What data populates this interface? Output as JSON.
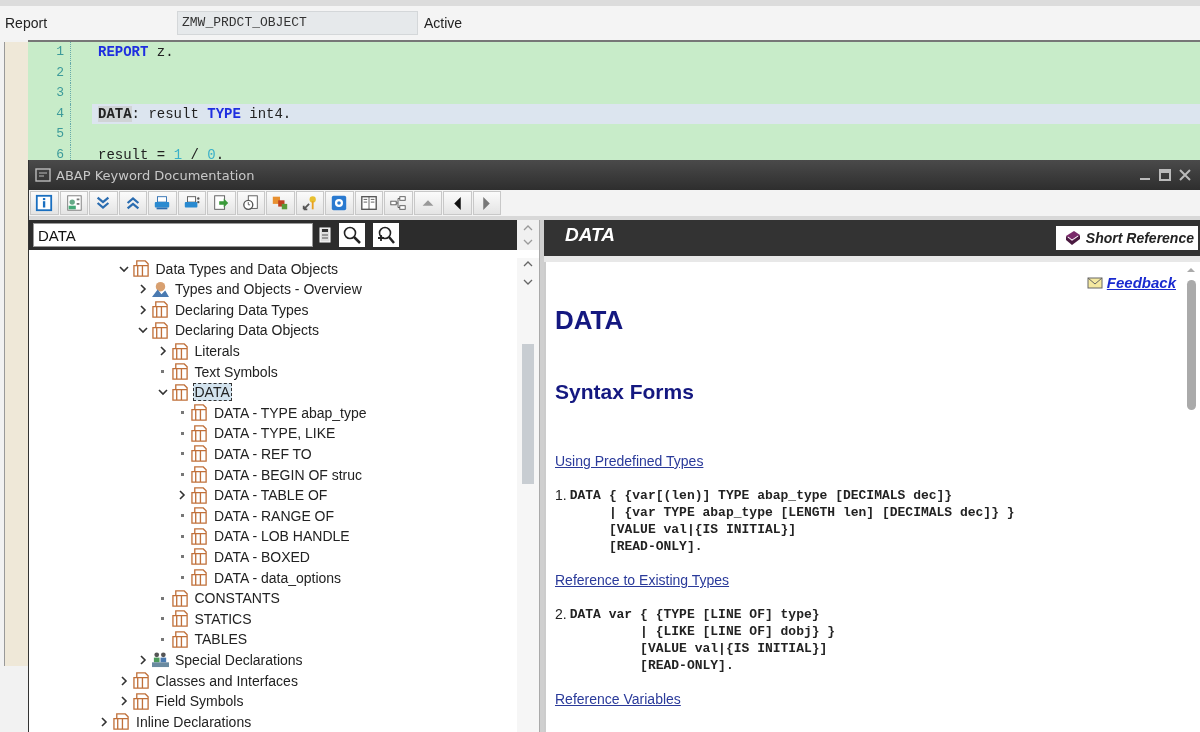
{
  "header": {
    "label": "Report",
    "program": "ZMW_PRDCT_OBJECT",
    "status": "Active"
  },
  "editor": {
    "lines": [
      {
        "number": "1",
        "highlighted": false,
        "tokens": [
          {
            "kind": "keyword",
            "text": "REPORT"
          },
          {
            "kind": "text",
            "text": " z."
          }
        ]
      },
      {
        "number": "2",
        "highlighted": false
      },
      {
        "number": "3",
        "highlighted": false
      },
      {
        "number": "4",
        "highlighted": true,
        "tokens": [
          {
            "kind": "marked",
            "text": "DATA"
          },
          {
            "kind": "text",
            "text": ": result "
          },
          {
            "kind": "keyword",
            "text": "TYPE"
          },
          {
            "kind": "text",
            "text": " int4."
          }
        ]
      },
      {
        "number": "5",
        "highlighted": false
      },
      {
        "number": "6",
        "highlighted": false,
        "tokens": [
          {
            "kind": "text",
            "text": "result = "
          },
          {
            "kind": "number",
            "text": "1"
          },
          {
            "kind": "text",
            "text": " / "
          },
          {
            "kind": "number",
            "text": "0"
          },
          {
            "kind": "text",
            "text": "."
          }
        ]
      }
    ]
  },
  "doc_window": {
    "title": "ABAP Keyword Documentation",
    "search": {
      "value": "DATA"
    },
    "tree": {
      "scrolled_branch": [
        {
          "label": "Data Types and Data Objects",
          "expandable": true,
          "expanded": true,
          "kind": "topic",
          "selected": false,
          "children": [
            {
              "label": "Types and Objects - Overview",
              "expandable": true,
              "expanded": false,
              "kind": "overview",
              "selected": false
            },
            {
              "label": "Declaring Data Types",
              "expandable": true,
              "expanded": false,
              "kind": "topic",
              "selected": false
            },
            {
              "label": "Declaring Data Objects",
              "expandable": true,
              "expanded": true,
              "kind": "topic",
              "selected": false,
              "children": [
                {
                  "label": "Literals",
                  "expandable": true,
                  "expanded": false,
                  "kind": "topic",
                  "selected": false
                },
                {
                  "label": "Text Symbols",
                  "expandable": false,
                  "kind": "topic",
                  "selected": false
                },
                {
                  "label": "DATA",
                  "expandable": true,
                  "expanded": true,
                  "kind": "topic",
                  "selected": true,
                  "children": [
                    {
                      "label": "DATA - TYPE abap_type",
                      "expandable": false,
                      "kind": "topic",
                      "selected": false
                    },
                    {
                      "label": "DATA - TYPE, LIKE",
                      "expandable": false,
                      "kind": "topic",
                      "selected": false
                    },
                    {
                      "label": "DATA - REF TO",
                      "expandable": false,
                      "kind": "topic",
                      "selected": false
                    },
                    {
                      "label": "DATA - BEGIN OF struc",
                      "expandable": false,
                      "kind": "topic",
                      "selected": false
                    },
                    {
                      "label": "DATA - TABLE OF",
                      "expandable": true,
                      "expanded": false,
                      "kind": "topic",
                      "selected": false
                    },
                    {
                      "label": "DATA - RANGE OF",
                      "expandable": false,
                      "kind": "topic",
                      "selected": false
                    },
                    {
                      "label": "DATA - LOB HANDLE",
                      "expandable": false,
                      "kind": "topic",
                      "selected": false
                    },
                    {
                      "label": "DATA - BOXED",
                      "expandable": false,
                      "kind": "topic",
                      "selected": false
                    },
                    {
                      "label": "DATA - data_options",
                      "expandable": false,
                      "kind": "topic",
                      "selected": false
                    }
                  ]
                },
                {
                  "label": "CONSTANTS",
                  "expandable": false,
                  "kind": "topic",
                  "selected": false
                },
                {
                  "label": "STATICS",
                  "expandable": false,
                  "kind": "topic",
                  "selected": false
                },
                {
                  "label": "TABLES",
                  "expandable": false,
                  "kind": "topic",
                  "selected": false
                }
              ]
            },
            {
              "label": "Special Declarations",
              "expandable": true,
              "expanded": false,
              "kind": "special",
              "selected": false
            }
          ]
        },
        {
          "label": "Classes and Interfaces",
          "expandable": true,
          "expanded": false,
          "kind": "topic",
          "selected": false
        },
        {
          "label": "Field Symbols",
          "expandable": true,
          "expanded": false,
          "kind": "topic",
          "selected": false
        }
      ],
      "nodes": [
        {
          "label": "Inline Declarations",
          "expandable": true,
          "expanded": false,
          "kind": "topic",
          "selected": false
        }
      ]
    },
    "topic": {
      "title": "DATA",
      "short_reference": "Short Reference",
      "feedback": "Feedback",
      "heading": "DATA",
      "subheading": "Syntax Forms",
      "sections": [
        {
          "link": "Using Predefined Types",
          "number": "1.",
          "lead": "DATA",
          "lines": [
            "{ {var[(len)] TYPE abap_type [DECIMALS dec]}",
            "| {var TYPE abap_type [LENGTH len] [DECIMALS dec]} }",
            "[VALUE val|{IS INITIAL}]",
            "[READ-ONLY]."
          ]
        },
        {
          "link": "Reference to Existing Types",
          "number": "2.",
          "lead": "DATA var",
          "lines": [
            "{ {TYPE [LINE OF] type}",
            "| {LIKE [LINE OF] dobj} }",
            "[VALUE val|{IS INITIAL}]",
            "[READ-ONLY]."
          ]
        },
        {
          "link": "Reference Variables"
        }
      ]
    }
  }
}
